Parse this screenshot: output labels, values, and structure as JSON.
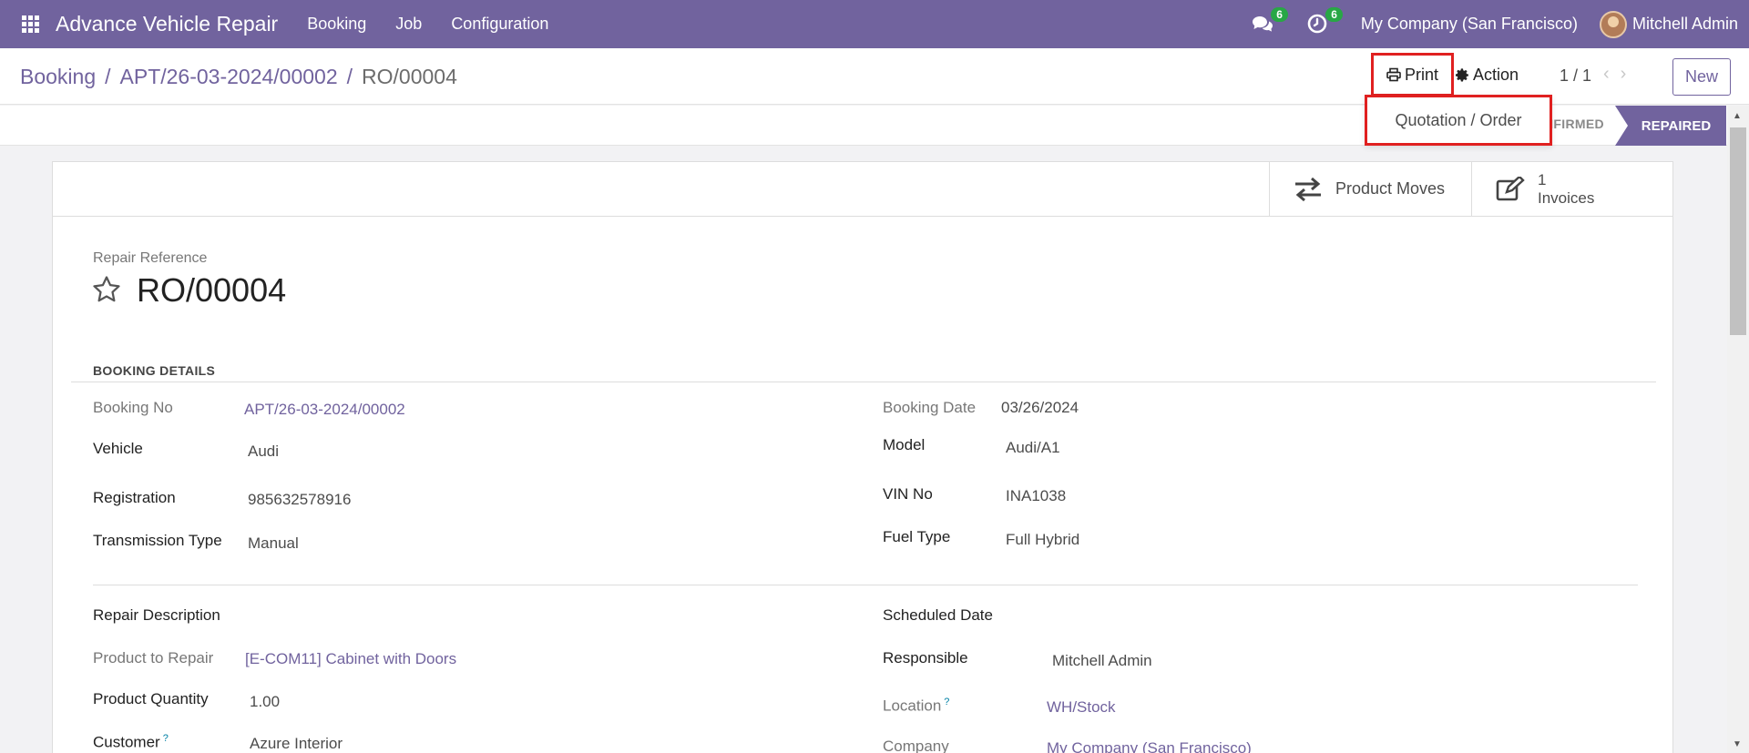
{
  "navbar": {
    "app_title": "Advance Vehicle Repair",
    "menu": [
      "Booking",
      "Job",
      "Configuration"
    ],
    "messages_count": "6",
    "activities_count": "6",
    "company": "My Company (San Francisco)",
    "user": "Mitchell Admin"
  },
  "control": {
    "breadcrumb": {
      "first": "Booking",
      "second": "APT/26-03-2024/00002",
      "current": "RO/00004",
      "sep": "/"
    },
    "print_label": "Print",
    "action_label": "Action",
    "pager": "1 / 1",
    "new_label": "New"
  },
  "print_menu": {
    "item": "Quotation / Order"
  },
  "status": {
    "confirmed": "NFIRMED",
    "repaired": "REPAIRED"
  },
  "smart_buttons": {
    "moves": "Product Moves",
    "invoices_count": "1",
    "invoices_label": "Invoices"
  },
  "form": {
    "ref_label": "Repair Reference",
    "ref": "RO/00004",
    "section": "BOOKING DETAILS",
    "booking_no_label": "Booking No",
    "booking_no": "APT/26-03-2024/00002",
    "booking_date_label": "Booking Date",
    "booking_date": "03/26/2024",
    "vehicle_label": "Vehicle",
    "vehicle": "Audi",
    "model_label": "Model",
    "model": "Audi/A1",
    "registration_label": "Registration",
    "registration": "985632578916",
    "vin_label": "VIN No",
    "vin": "INA1038",
    "transmission_label": "Transmission Type",
    "transmission": "Manual",
    "fuel_label": "Fuel Type",
    "fuel": "Full Hybrid",
    "repair_desc_label": "Repair Description",
    "scheduled_label": "Scheduled Date",
    "product_label": "Product to Repair",
    "product": "[E-COM11] Cabinet with Doors",
    "responsible_label": "Responsible",
    "responsible": "Mitchell Admin",
    "qty_label": "Product Quantity",
    "qty": "1.00",
    "location_label": "Location",
    "location": "WH/Stock",
    "customer_label": "Customer",
    "customer": "Azure Interior",
    "company_label": "Company",
    "company": "My Company (San Francisco)",
    "tooltip_mark": "?"
  }
}
